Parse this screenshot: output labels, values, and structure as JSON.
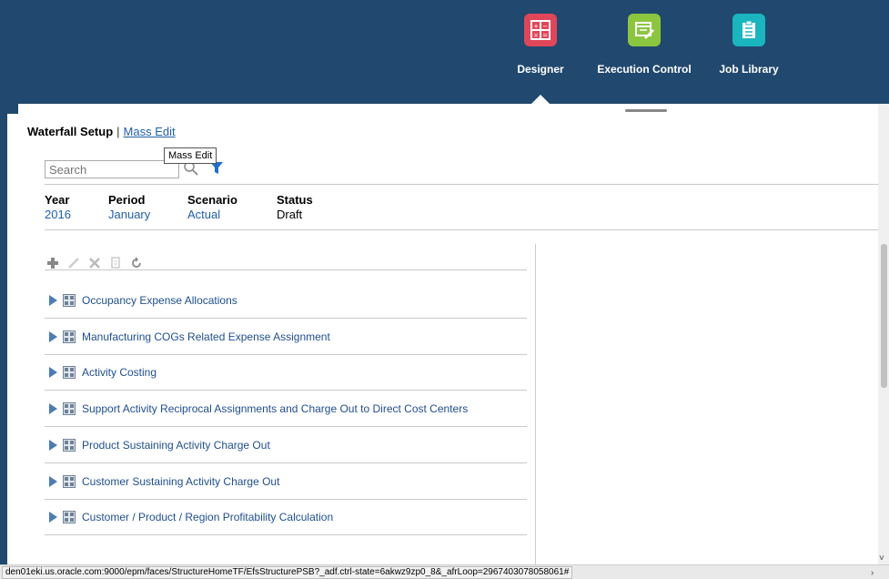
{
  "nav": {
    "apps": [
      {
        "label": "Designer",
        "icon": "designer-icon",
        "color": "#e0465a"
      },
      {
        "label": "Execution Control",
        "icon": "execution-control-icon",
        "color": "#8cc63f"
      },
      {
        "label": "Job Library",
        "icon": "job-library-icon",
        "color": "#1ab5bf"
      }
    ],
    "active": "Designer"
  },
  "header": {
    "current_tab": "Waterfall Setup",
    "separator": "|",
    "link_tab": "Mass Edit",
    "tooltip": "Mass Edit"
  },
  "search": {
    "placeholder": "Search"
  },
  "info": {
    "year": {
      "label": "Year",
      "value": "2016"
    },
    "period": {
      "label": "Period",
      "value": "January"
    },
    "scenario": {
      "label": "Scenario",
      "value": "Actual"
    },
    "status": {
      "label": "Status",
      "value": "Draft"
    }
  },
  "toolbar": [
    "add-icon",
    "edit-icon",
    "delete-icon",
    "copy-icon",
    "refresh-icon"
  ],
  "rules": [
    "Occupancy Expense Allocations",
    "Manufacturing COGs Related Expense Assignment",
    "Activity Costing",
    "Support Activity Reciprocal Assignments and Charge Out to Direct Cost Centers",
    "Product Sustaining Activity Charge Out",
    "Customer Sustaining Activity Charge Out",
    "Customer / Product / Region Profitability Calculation"
  ],
  "status_bar": {
    "url": "den01eki.us.oracle.com:9000/epm/faces/StructureHomeTF/EfsStructurePSB?_adf.ctrl-state=6akwz9zp0_8&_afrLoop=2967403078058061#"
  },
  "colors": {
    "header_bg": "#21486e",
    "link": "#1f5fa8",
    "rule_text": "#1f4e8f"
  }
}
